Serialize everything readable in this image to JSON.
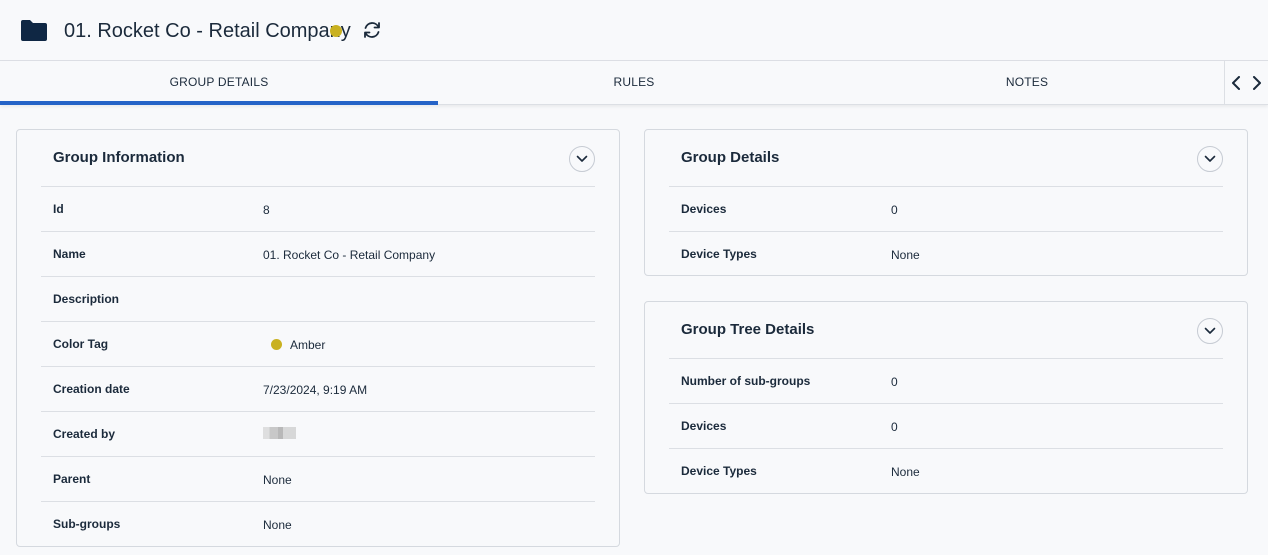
{
  "header": {
    "title": "01. Rocket Co - Retail Company",
    "status_color": "#c9b120",
    "icon": "folder-icon",
    "refresh_icon": "refresh-icon"
  },
  "tabs": [
    {
      "label": "GROUP DETAILS",
      "active": true
    },
    {
      "label": "RULES",
      "active": false
    },
    {
      "label": "NOTES",
      "active": false
    }
  ],
  "group_information": {
    "title": "Group Information",
    "rows": [
      {
        "label": "Id",
        "value": "8"
      },
      {
        "label": "Name",
        "value": "01. Rocket Co - Retail Company"
      },
      {
        "label": "Description",
        "value": ""
      },
      {
        "label": "Color Tag",
        "value": "Amber",
        "color": "#c9b120"
      },
      {
        "label": "Creation date",
        "value": "7/23/2024, 9:19 AM"
      },
      {
        "label": "Created by",
        "value": ""
      },
      {
        "label": "Parent",
        "value": "None"
      },
      {
        "label": "Sub-groups",
        "value": "None"
      }
    ]
  },
  "group_details": {
    "title": "Group Details",
    "rows": [
      {
        "label": "Devices",
        "value": "0"
      },
      {
        "label": "Device Types",
        "value": "None"
      }
    ]
  },
  "group_tree_details": {
    "title": "Group Tree Details",
    "rows": [
      {
        "label": "Number of sub-groups",
        "value": "0"
      },
      {
        "label": "Devices",
        "value": "0"
      },
      {
        "label": "Device Types",
        "value": "None"
      }
    ]
  },
  "colors": {
    "accent": "#2563c7",
    "text": "#1b2a3b",
    "amber": "#c9b120"
  }
}
